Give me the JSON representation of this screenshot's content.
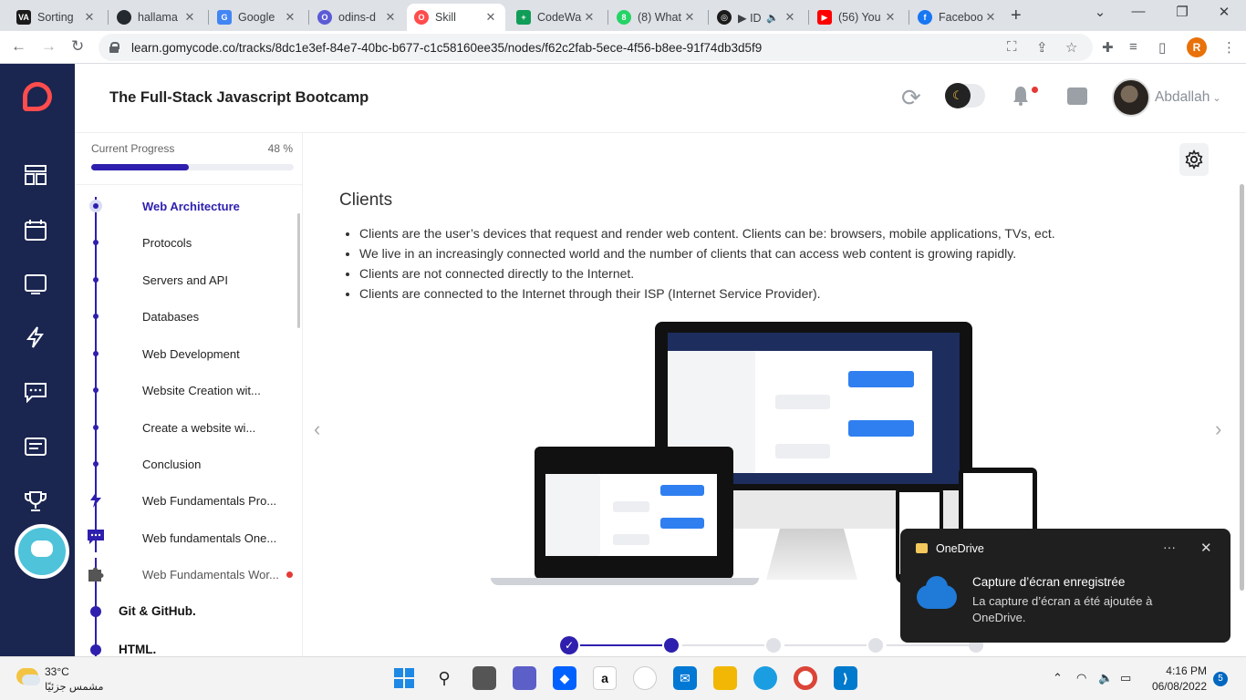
{
  "browser": {
    "tabs": [
      {
        "title": "Sorting",
        "favicon_color": "#1b1b1b",
        "favicon_text": "VA"
      },
      {
        "title": "hallama",
        "favicon_color": "#24292f",
        "favicon_text": "GH"
      },
      {
        "title": "Google",
        "favicon_color": "#4285f4",
        "favicon_text": "G"
      },
      {
        "title": "odins-d",
        "favicon_color": "#5b5bd6",
        "favicon_text": "O"
      },
      {
        "title": "Skill",
        "favicon_color": "#ff4c4c",
        "favicon_text": "O"
      },
      {
        "title": "CodeWa",
        "favicon_color": "#0f9d58",
        "favicon_text": "+"
      },
      {
        "title": "(8) What",
        "favicon_color": "#25d366",
        "favicon_text": "8"
      },
      {
        "title": "▶ ID",
        "favicon_color": "#1b1b1b",
        "favicon_text": "◎"
      },
      {
        "title": "(56) You",
        "favicon_color": "#ff0000",
        "favicon_text": "▶"
      },
      {
        "title": "Faceboo",
        "favicon_color": "#1877f2",
        "favicon_text": "f"
      }
    ],
    "url": "learn.gomycode.co/tracks/8dc1e3ef-84e7-40bc-b677-c1c58160ee35/nodes/f62c2fab-5ece-4f56-b8ee-91f74db3d5f9",
    "profile_initial": "R"
  },
  "header": {
    "title": "The Full-Stack Javascript Bootcamp",
    "username": "Abdallah"
  },
  "progress": {
    "label": "Current Progress",
    "percent_text": "48 %",
    "value": 0.48
  },
  "outline": {
    "items": [
      {
        "label": "Web Architecture",
        "state": "active"
      },
      {
        "label": "Protocols",
        "state": "normal"
      },
      {
        "label": "Servers and API",
        "state": "normal"
      },
      {
        "label": "Databases",
        "state": "normal"
      },
      {
        "label": "Web Development",
        "state": "normal"
      },
      {
        "label": "Website Creation wit...",
        "state": "normal"
      },
      {
        "label": "Create a website wi...",
        "state": "normal"
      },
      {
        "label": "Conclusion",
        "state": "normal"
      },
      {
        "label": "Web Fundamentals Pro...",
        "state": "normal",
        "icon": "lightning-icon"
      },
      {
        "label": "Web fundamentals One...",
        "state": "normal",
        "icon": "chat-icon"
      },
      {
        "label": "Web Fundamentals Wor...",
        "state": "dim",
        "icon": "puzzle-icon",
        "marker": "red-dot"
      }
    ],
    "sections": [
      "Git & GitHub.",
      "HTML."
    ]
  },
  "content": {
    "title": "Clients",
    "bullets": [
      "Clients are the user’s devices that request and render web content. Clients can be: browsers, mobile applications, TVs, ect.",
      "We live in an increasingly connected world and the number of clients that can access web content is growing rapidly.",
      "Clients are not connected directly to the Internet.",
      "Clients are connected to the Internet through their ISP (Internet Service Provider)."
    ]
  },
  "toast": {
    "app": "OneDrive",
    "title": "Capture d’écran enregistrée",
    "body": "La capture d’écran a été ajoutée à OneDrive."
  },
  "taskbar": {
    "temperature": "33°C",
    "weather": "مشمس جزئيًا",
    "time": "4:16 PM",
    "date": "06/08/2022",
    "notifications": "5"
  },
  "colors": {
    "primary": "#2e1fae",
    "rail": "#1a2550",
    "brand": "#ff4c4c"
  }
}
